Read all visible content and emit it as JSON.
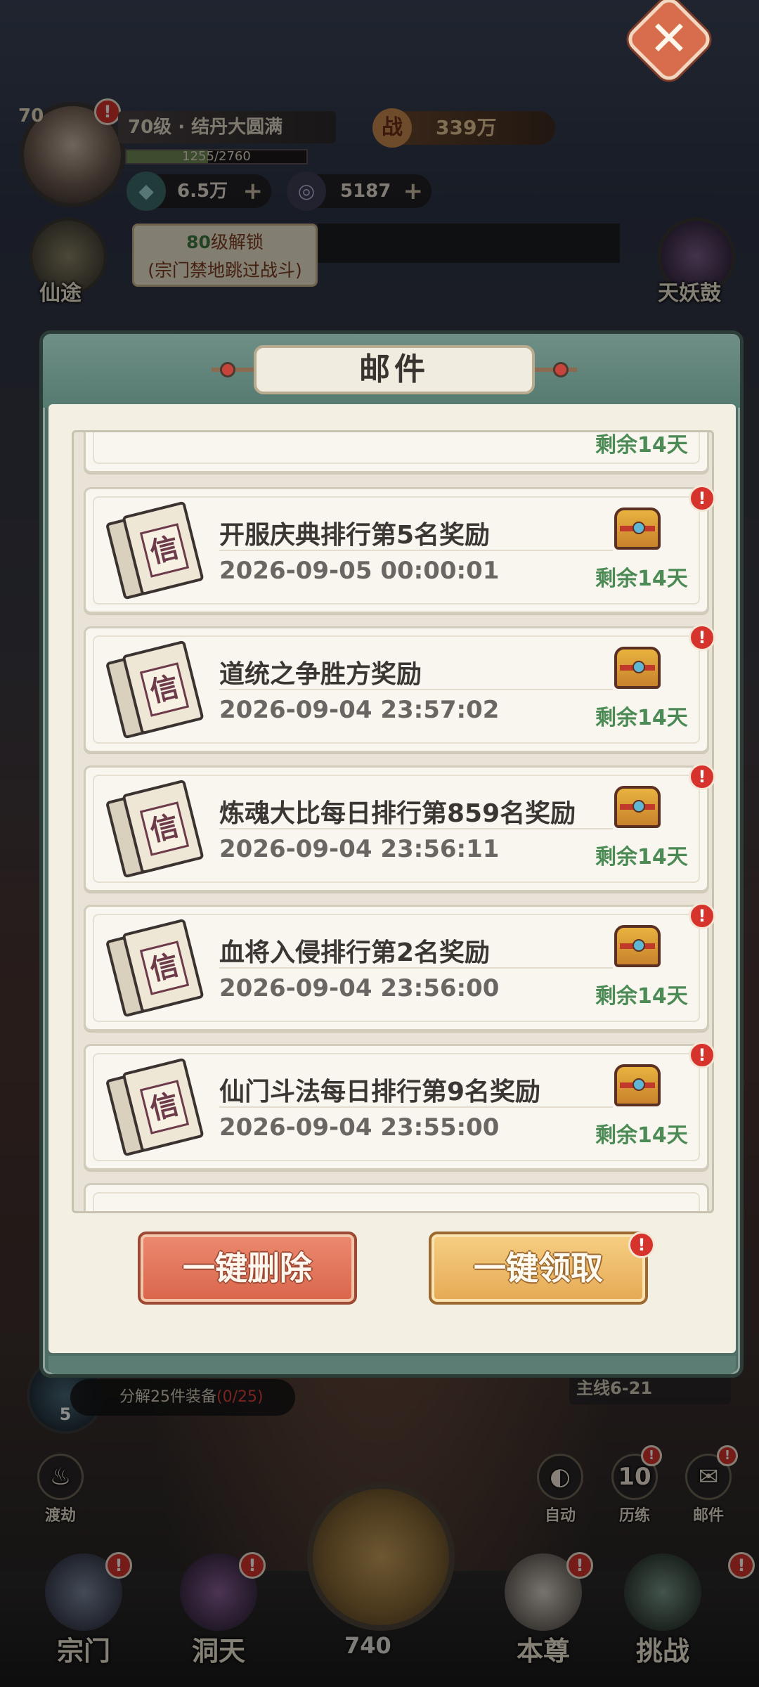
{
  "hud": {
    "avatar_level": "70",
    "level_text": "70级 · 结丹大圆满",
    "exp_text": "1255/2760",
    "exp_progress": 0.4547,
    "power_icon": "战",
    "power_value": "339万",
    "currency1_value": "6.5万",
    "currency1_icon": "gem-icon",
    "currency2_value": "5187",
    "currency2_icon": "spirit-coin-icon",
    "unlock_level": "80",
    "unlock_suffix": "级解锁",
    "unlock_desc": "(宗门禁地跳过战斗)",
    "left_icon_label": "仙途",
    "right_icon_label": "天妖鼓",
    "task_count": "5",
    "task_text": "分解25件装备",
    "task_progress": "(0/25)",
    "mainline": "主线6-21",
    "dujie": "渡劫",
    "auto": "自动",
    "lilian_count": "10",
    "lilian": "历练",
    "mail": "邮件",
    "main_value": "740",
    "nav": [
      "宗门",
      "洞天",
      "本尊",
      "挑战"
    ]
  },
  "dialog": {
    "title": "邮件",
    "close_icon": "close-icon",
    "mails": [
      {
        "title": "开服庆典排行第5名奖励",
        "time": "2026-09-05 00:00:01",
        "remain": "剩余14天"
      },
      {
        "title": "道统之争胜方奖励",
        "time": "2026-09-04 23:57:02",
        "remain": "剩余14天"
      },
      {
        "title": "炼魂大比每日排行第859名奖励",
        "time": "2026-09-04 23:56:11",
        "remain": "剩余14天"
      },
      {
        "title": "血将入侵排行第2名奖励",
        "time": "2026-09-04 23:56:00",
        "remain": "剩余14天"
      },
      {
        "title": "仙门斗法每日排行第9名奖励",
        "time": "2026-09-04 23:55:00",
        "remain": "剩余14天"
      }
    ],
    "partial_top_remain": "剩余14天",
    "envelope_char": "信",
    "alert_mark": "!",
    "delete_all": "一键删除",
    "claim_all": "一键领取"
  },
  "colors": {
    "dialog_frame": "#4f6e66",
    "remain_green": "#4c8b55",
    "alert_red": "#d6332c",
    "delete_btn": "#d9654b",
    "claim_btn": "#e5a954"
  }
}
